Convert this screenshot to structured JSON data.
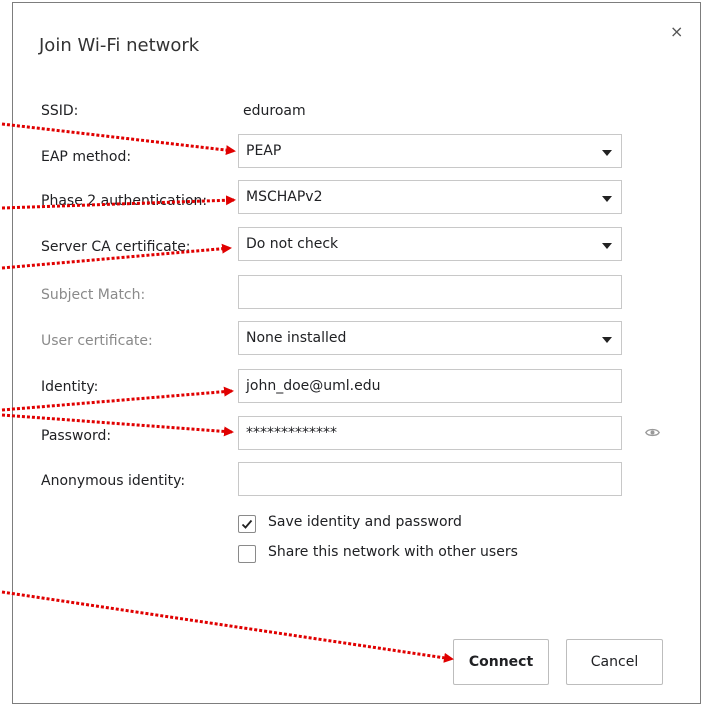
{
  "dialog": {
    "title": "Join Wi-Fi network",
    "close_glyph": "×"
  },
  "fields": {
    "ssid": {
      "label": "SSID:",
      "value": "eduroam"
    },
    "eap_method": {
      "label": "EAP method:",
      "value": "PEAP"
    },
    "phase2": {
      "label": "Phase 2 authentication:",
      "value": "MSCHAPv2"
    },
    "server_ca": {
      "label": "Server CA certificate:",
      "value": "Do not check"
    },
    "subject_match": {
      "label": "Subject Match:",
      "value": ""
    },
    "user_cert": {
      "label": "User certificate:",
      "value": "None installed"
    },
    "identity": {
      "label": "Identity:",
      "value": "john_doe@uml.edu"
    },
    "password": {
      "label": "Password:",
      "value": "*************"
    },
    "anon_identity": {
      "label": "Anonymous identity:",
      "value": ""
    }
  },
  "checkboxes": {
    "save_identity": {
      "label": "Save identity and password",
      "checked": true
    },
    "share_network": {
      "label": "Share this network with other users",
      "checked": false
    }
  },
  "buttons": {
    "connect": "Connect",
    "cancel": "Cancel"
  },
  "icons": {
    "password_toggle": "eye-icon",
    "close": "close-icon",
    "dropdown": "chevron-down-icon",
    "check": "check-icon"
  },
  "colors": {
    "annotation_arrow": "#e00000",
    "dialog_border": "#7d7d7d",
    "field_border": "#c8c8c8",
    "disabled_label": "#8a8a8a"
  }
}
